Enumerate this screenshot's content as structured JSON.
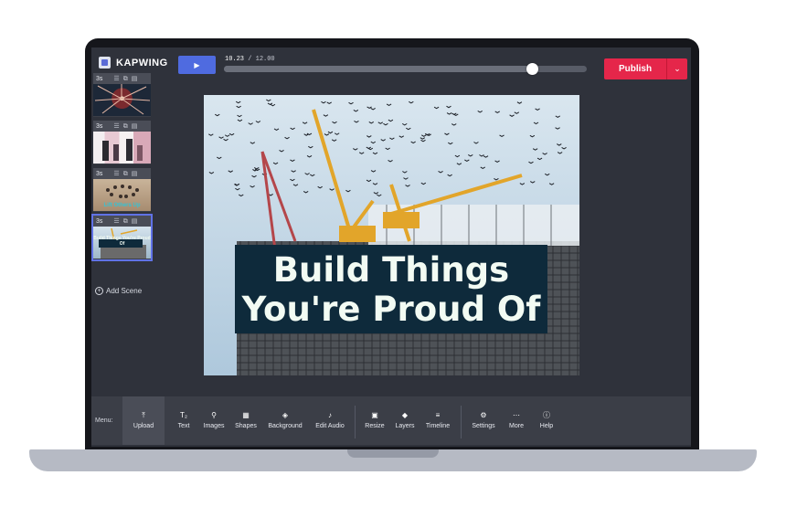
{
  "app": {
    "name": "KAPWING"
  },
  "player": {
    "play_icon": "play-icon",
    "current_time": "10.23",
    "separator": "/",
    "total_time": "12.00",
    "progress_fraction": 0.85
  },
  "publish": {
    "label": "Publish",
    "caret": "chevron-down-icon"
  },
  "scenes": [
    {
      "duration": "3s",
      "caption": ""
    },
    {
      "duration": "3s",
      "caption": ""
    },
    {
      "duration": "3s",
      "caption": "Lift Others Up"
    },
    {
      "duration": "3s",
      "caption": "Build Things You're Proud Of"
    }
  ],
  "add_scene": {
    "label": "Add Scene"
  },
  "canvas": {
    "headline_line1": "Build Things",
    "headline_line2": "You're Proud Of"
  },
  "menu": {
    "title": "Menu:",
    "items": [
      {
        "label": "Upload",
        "icon": "upload-icon",
        "active": true
      },
      {
        "label": "Text",
        "icon": "text-icon"
      },
      {
        "label": "Images",
        "icon": "search-icon"
      },
      {
        "label": "Shapes",
        "icon": "shapes-icon"
      },
      {
        "label": "Background",
        "icon": "paint-bucket-icon"
      },
      {
        "label": "Edit Audio",
        "icon": "music-note-icon"
      },
      {
        "label": "Resize",
        "icon": "resize-icon"
      },
      {
        "label": "Layers",
        "icon": "layers-icon"
      },
      {
        "label": "Timeline",
        "icon": "timeline-icon"
      },
      {
        "label": "Settings",
        "icon": "gear-icon"
      },
      {
        "label": "More",
        "icon": "more-icon"
      },
      {
        "label": "Help",
        "icon": "help-icon"
      }
    ]
  },
  "colors": {
    "publish": "#e5264a",
    "play": "#4f6be0",
    "headline_bg": "#0e2a3b",
    "app_bg": "#2f323b"
  }
}
